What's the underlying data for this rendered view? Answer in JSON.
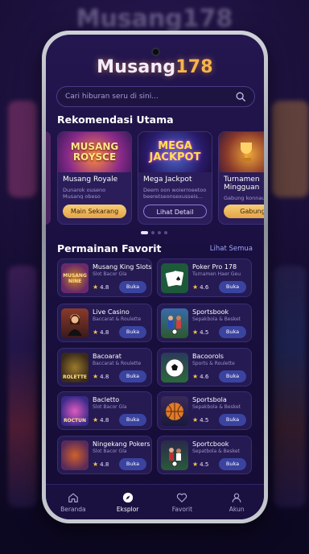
{
  "brand": {
    "prefix": "Musang",
    "suffix": "178"
  },
  "search": {
    "placeholder": "Cari hiburan seru di sini..."
  },
  "recommend": {
    "title": "Rekomendasi Utama",
    "cards": [
      {
        "art": "MUSANG ROYSCE",
        "name": "Musang Royale",
        "desc": "Dunarok ouseno Musang obeso eksoluelo.",
        "button": "Main Sekarang",
        "style": "gold"
      },
      {
        "art": "MEGA JACKPOT",
        "name": "Mega Jackpot",
        "desc": "Deem oon woierroeetoo beeretseonsexusseis...",
        "button": "Lihat Detail",
        "style": "outline"
      },
      {
        "art": "",
        "name": "Turnamen Mingguan",
        "desc": "Gabung konnauo",
        "button": "Gabung",
        "style": "gold"
      }
    ],
    "page_count": 4,
    "active_page": 1
  },
  "favorites": {
    "title": "Permainan Favorit",
    "see_all": "Lihat Semua",
    "games": [
      {
        "thumb": "MUSANG NINE",
        "name": "Musang King Slots",
        "sub": "Slot Bacor Gla",
        "rating": "4.8",
        "button": "Buka"
      },
      {
        "thumb": "",
        "name": "Poker Pro 178",
        "sub": "Turnamen Haer Geu",
        "rating": "4.6",
        "button": "Buka"
      },
      {
        "thumb": "",
        "name": "Live Casino",
        "sub": "Baccarat & Roulette",
        "rating": "4.8",
        "button": "Buka"
      },
      {
        "thumb": "",
        "name": "Sportsbook",
        "sub": "Sepakbola & Besket",
        "rating": "4.5",
        "button": "Buka"
      },
      {
        "thumb": "ROLETTE",
        "name": "Bacoarat",
        "sub": "Baccarat & Roulette",
        "rating": "4.8",
        "button": "Buka"
      },
      {
        "thumb": "",
        "name": "Bacoorols",
        "sub": "Sports & Roulette",
        "rating": "4.6",
        "button": "Buka"
      },
      {
        "thumb": "ROCTUN",
        "name": "Bacletto",
        "sub": "Slot Bacor Gla",
        "rating": "4.8",
        "button": "Buka"
      },
      {
        "thumb": "",
        "name": "Sportsbola",
        "sub": "Sepakbola & Besket",
        "rating": "4.5",
        "button": "Buka"
      },
      {
        "thumb": "",
        "name": "Ningekang Pokers",
        "sub": "Slot Bacor Gla",
        "rating": "4.8",
        "button": "Buka"
      },
      {
        "thumb": "",
        "name": "Sportcbook",
        "sub": "Sepatbola & Besket",
        "rating": "4.5",
        "button": "Buka"
      }
    ]
  },
  "nav": [
    {
      "label": "Beranda",
      "icon": "home-icon"
    },
    {
      "label": "Eksplor",
      "icon": "compass-icon"
    },
    {
      "label": "Favorit",
      "icon": "heart-icon"
    },
    {
      "label": "Akun",
      "icon": "user-icon"
    }
  ],
  "bg_title": "Musang178"
}
